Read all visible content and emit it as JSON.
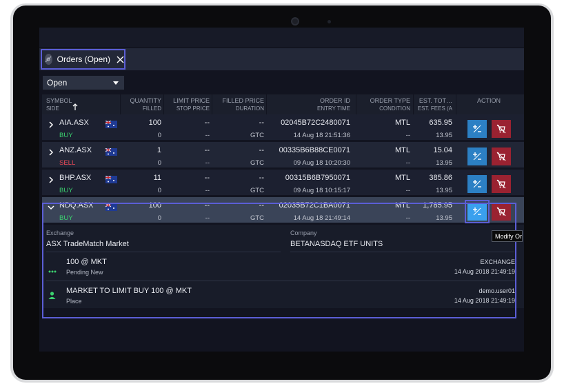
{
  "tab": {
    "label": "Orders (Open)",
    "icon": "satellite-icon"
  },
  "filter": {
    "selected": "Open"
  },
  "columns": [
    {
      "top": "SYMBOL",
      "bottom": "SIDE"
    },
    {
      "top": "QUANTITY",
      "bottom": "FILLED"
    },
    {
      "top": "LIMIT PRICE",
      "bottom": "STOP PRICE"
    },
    {
      "top": "FILLED PRICE",
      "bottom": "DURATION"
    },
    {
      "top": "ORDER ID",
      "bottom": "ENTRY TIME"
    },
    {
      "top": "ORDER TYPE",
      "bottom": "CONDITION"
    },
    {
      "top": "EST. TOT…",
      "bottom": "EST. FEES (A"
    },
    {
      "top": "ACTION",
      "bottom": ""
    }
  ],
  "orders": [
    {
      "symbol": "AIA.ASX",
      "side": "BUY",
      "quantity": "100",
      "filled": "0",
      "limit": "--",
      "stop": "--",
      "filled_price": "--",
      "duration": "GTC",
      "order_id": "02045B72C2480071",
      "entry_time": "14 Aug 18 21:51:36",
      "order_type": "MTL",
      "condition": "--",
      "est_total": "635.95",
      "est_fees": "13.95"
    },
    {
      "symbol": "ANZ.ASX",
      "side": "SELL",
      "quantity": "1",
      "filled": "0",
      "limit": "--",
      "stop": "--",
      "filled_price": "--",
      "duration": "GTC",
      "order_id": "00335B6B88CE0071",
      "entry_time": "09 Aug 18 10:20:30",
      "order_type": "MTL",
      "condition": "--",
      "est_total": "15.04",
      "est_fees": "13.95"
    },
    {
      "symbol": "BHP.ASX",
      "side": "BUY",
      "quantity": "11",
      "filled": "0",
      "limit": "--",
      "stop": "--",
      "filled_price": "--",
      "duration": "GTC",
      "order_id": "00315B6B7950071",
      "entry_time": "09 Aug 18 10:15:17",
      "order_type": "MTL",
      "condition": "--",
      "est_total": "385.86",
      "est_fees": "13.95"
    },
    {
      "symbol": "NDQ.ASX",
      "side": "BUY",
      "quantity": "100",
      "filled": "0",
      "limit": "--",
      "stop": "--",
      "filled_price": "--",
      "duration": "GTC",
      "order_id": "02035B72C1BA0071",
      "entry_time": "14 Aug 18 21:49:14",
      "order_type": "MTL",
      "condition": "--",
      "est_total": "1,785.95",
      "est_fees": "13.95"
    }
  ],
  "detail": {
    "exchange_label": "Exchange",
    "exchange_value": "ASX TradeMatch Market",
    "company_label": "Company",
    "company_value": "BETANASDAQ ETF UNITS",
    "events": [
      {
        "title": "100 @ MKT",
        "subtitle": "Pending New",
        "right_top": "EXCHANGE",
        "right_bottom": "14 Aug 2018 21:49:19",
        "icon": "ellipsis-icon"
      },
      {
        "title": "MARKET TO LIMIT BUY 100 @ MKT",
        "subtitle": "Place",
        "right_top": "demo.user01",
        "right_bottom": "14 Aug 2018 21:49:19",
        "icon": "user-icon"
      }
    ]
  },
  "tooltip": {
    "text": "Modify Orde"
  },
  "colors": {
    "accent": "#5b5ed6",
    "buy": "#3bd16f",
    "sell": "#ef4a58",
    "modify": "#2c80c4",
    "cancel": "#9a2231"
  }
}
